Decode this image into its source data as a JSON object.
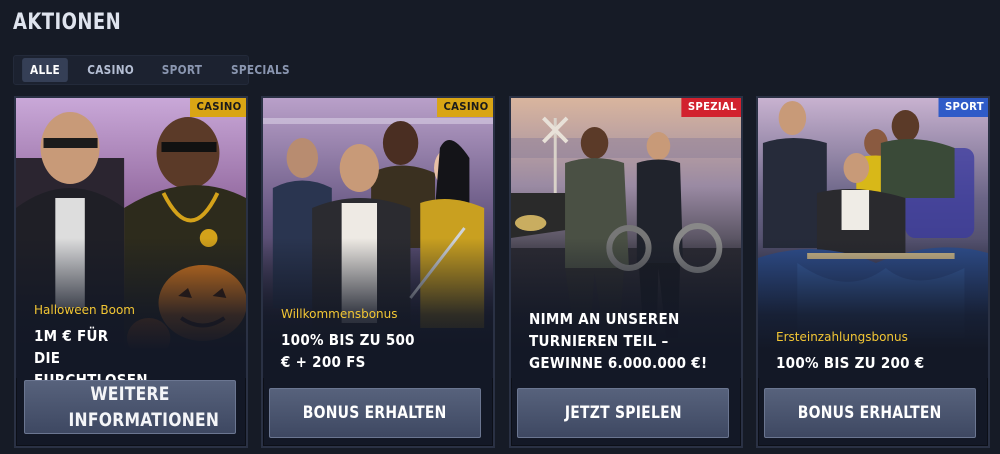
{
  "page": {
    "title": "AKTIONEN"
  },
  "filters": [
    {
      "label": "ALLE",
      "active": true
    },
    {
      "label": "CASINO",
      "active": false
    },
    {
      "label": "SPORT",
      "active": false
    },
    {
      "label": "SPECIALS",
      "active": false
    }
  ],
  "cards": [
    {
      "badge": "CASINO",
      "subtitle": "Halloween Boom",
      "headline": "1M € FÜR DIE FURCHTLOSEN",
      "cta": "WEITERE INFORMATIONEN"
    },
    {
      "badge": "CASINO",
      "subtitle": "Willkommensbonus",
      "headline": "100% BIS ZU 500 € + 200 FS",
      "cta": "BONUS ERHALTEN"
    },
    {
      "badge": "SPEZIAL",
      "subtitle": "",
      "headline": "NIMM AN UNSEREN TURNIEREN TEIL – GEWINNE 6.000.000 €!",
      "cta": "JETZT SPIELEN"
    },
    {
      "badge": "SPORT",
      "subtitle": "Ersteinzahlungsbonus",
      "headline": "100% BIS ZU 200 €",
      "cta": "BONUS ERHALTEN"
    }
  ],
  "colors": {
    "background": "#161b26",
    "badge_casino": "#d9a514",
    "badge_spezial": "#d2222e",
    "badge_sport": "#2f5bc8",
    "subtitle_accent": "#f2c634",
    "cta_button": "#4a5570"
  },
  "icons": {
    "card_1_art": "halloween-gangsters-illustration",
    "card_2_art": "welcome-gang-illustration",
    "card_3_art": "tournament-street-illustration",
    "card_4_art": "sport-lounge-illustration"
  }
}
